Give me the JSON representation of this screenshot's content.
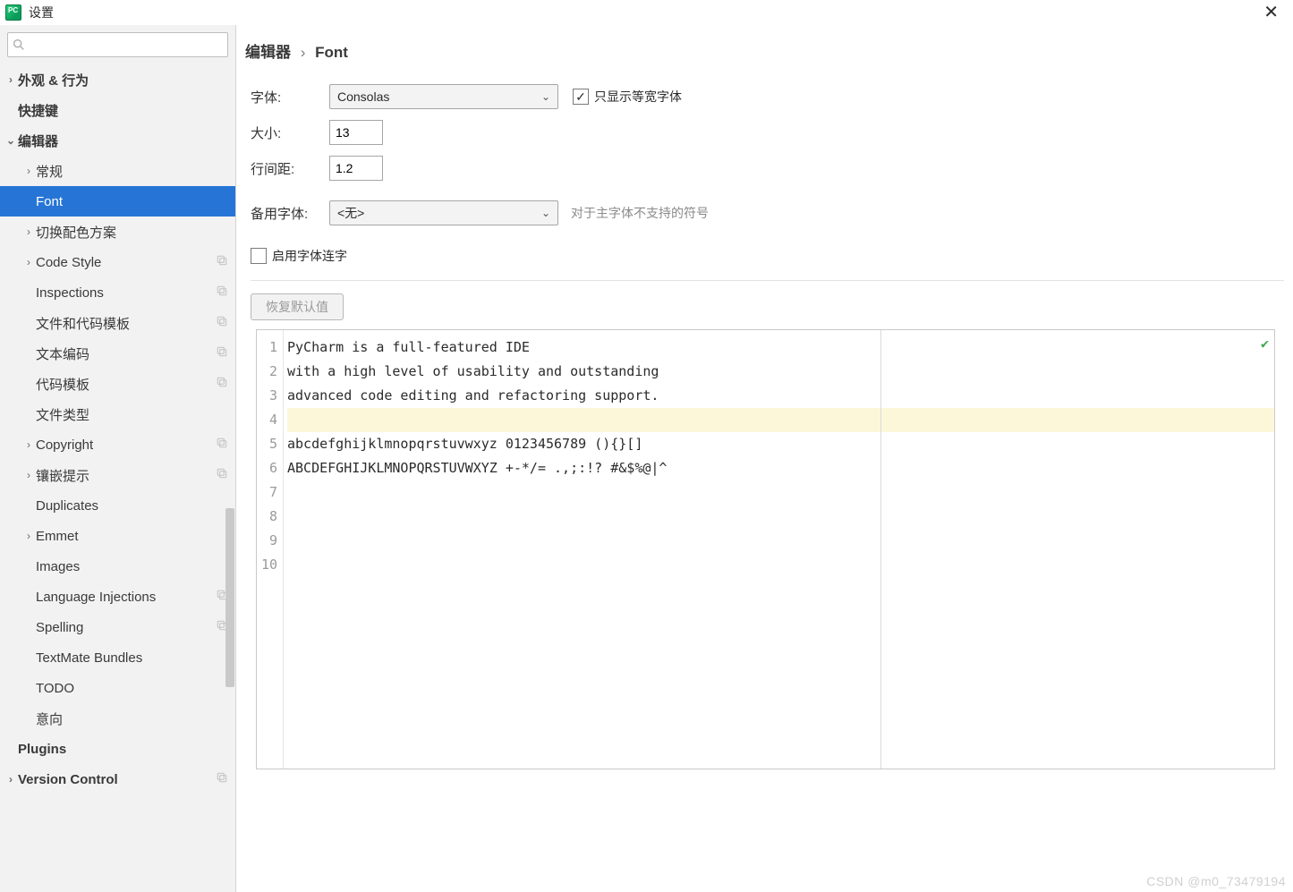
{
  "window": {
    "title": "设置"
  },
  "search": {
    "placeholder": ""
  },
  "sidebar": [
    {
      "label": "外观 & 行为",
      "level": 0,
      "arrow": "right"
    },
    {
      "label": "快捷键",
      "level": 0,
      "arrow": "none",
      "bold": true
    },
    {
      "label": "编辑器",
      "level": 0,
      "arrow": "down"
    },
    {
      "label": "常规",
      "level": 1,
      "arrow": "right"
    },
    {
      "label": "Font",
      "level": 1,
      "arrow": "none",
      "selected": true
    },
    {
      "label": "切换配色方案",
      "level": 1,
      "arrow": "right"
    },
    {
      "label": "Code Style",
      "level": 1,
      "arrow": "right",
      "copy": true
    },
    {
      "label": "Inspections",
      "level": 1,
      "arrow": "none",
      "copy": true
    },
    {
      "label": "文件和代码模板",
      "level": 1,
      "arrow": "none",
      "copy": true
    },
    {
      "label": "文本编码",
      "level": 1,
      "arrow": "none",
      "copy": true
    },
    {
      "label": "代码模板",
      "level": 1,
      "arrow": "none",
      "copy": true
    },
    {
      "label": "文件类型",
      "level": 1,
      "arrow": "none"
    },
    {
      "label": "Copyright",
      "level": 1,
      "arrow": "right",
      "copy": true
    },
    {
      "label": "镶嵌提示",
      "level": 1,
      "arrow": "right",
      "copy": true
    },
    {
      "label": "Duplicates",
      "level": 1,
      "arrow": "none"
    },
    {
      "label": "Emmet",
      "level": 1,
      "arrow": "right"
    },
    {
      "label": "Images",
      "level": 1,
      "arrow": "none"
    },
    {
      "label": "Language Injections",
      "level": 1,
      "arrow": "none",
      "copy": true
    },
    {
      "label": "Spelling",
      "level": 1,
      "arrow": "none",
      "copy": true
    },
    {
      "label": "TextMate Bundles",
      "level": 1,
      "arrow": "none"
    },
    {
      "label": "TODO",
      "level": 1,
      "arrow": "none"
    },
    {
      "label": "意向",
      "level": 1,
      "arrow": "none"
    },
    {
      "label": "Plugins",
      "level": 0,
      "arrow": "none",
      "bold": true
    },
    {
      "label": "Version Control",
      "level": 0,
      "arrow": "right",
      "copy": true
    }
  ],
  "breadcrumb": {
    "root": "编辑器",
    "leaf": "Font"
  },
  "form": {
    "font_label": "字体:",
    "font_value": "Consolas",
    "mono_only": "只显示等宽字体",
    "size_label": "大小:",
    "size_value": "13",
    "line_label": "行间距:",
    "line_value": "1.2",
    "fallback_label": "备用字体:",
    "fallback_value": "<无>",
    "fallback_hint": "对于主字体不支持的符号",
    "ligatures": "启用字体连字",
    "restore": "恢复默认值"
  },
  "preview": {
    "lines": [
      "PyCharm is a full-featured IDE",
      "with a high level of usability and outstanding",
      "advanced code editing and refactoring support.",
      "",
      "abcdefghijklmnopqrstuvwxyz 0123456789 (){}[]",
      "ABCDEFGHIJKLMNOPQRSTUVWXYZ +-*/= .,;:!? #&$%@|^",
      "",
      "",
      "",
      ""
    ],
    "highlight_index": 3,
    "line_count": 10
  },
  "watermark": "CSDN @m0_73479194"
}
